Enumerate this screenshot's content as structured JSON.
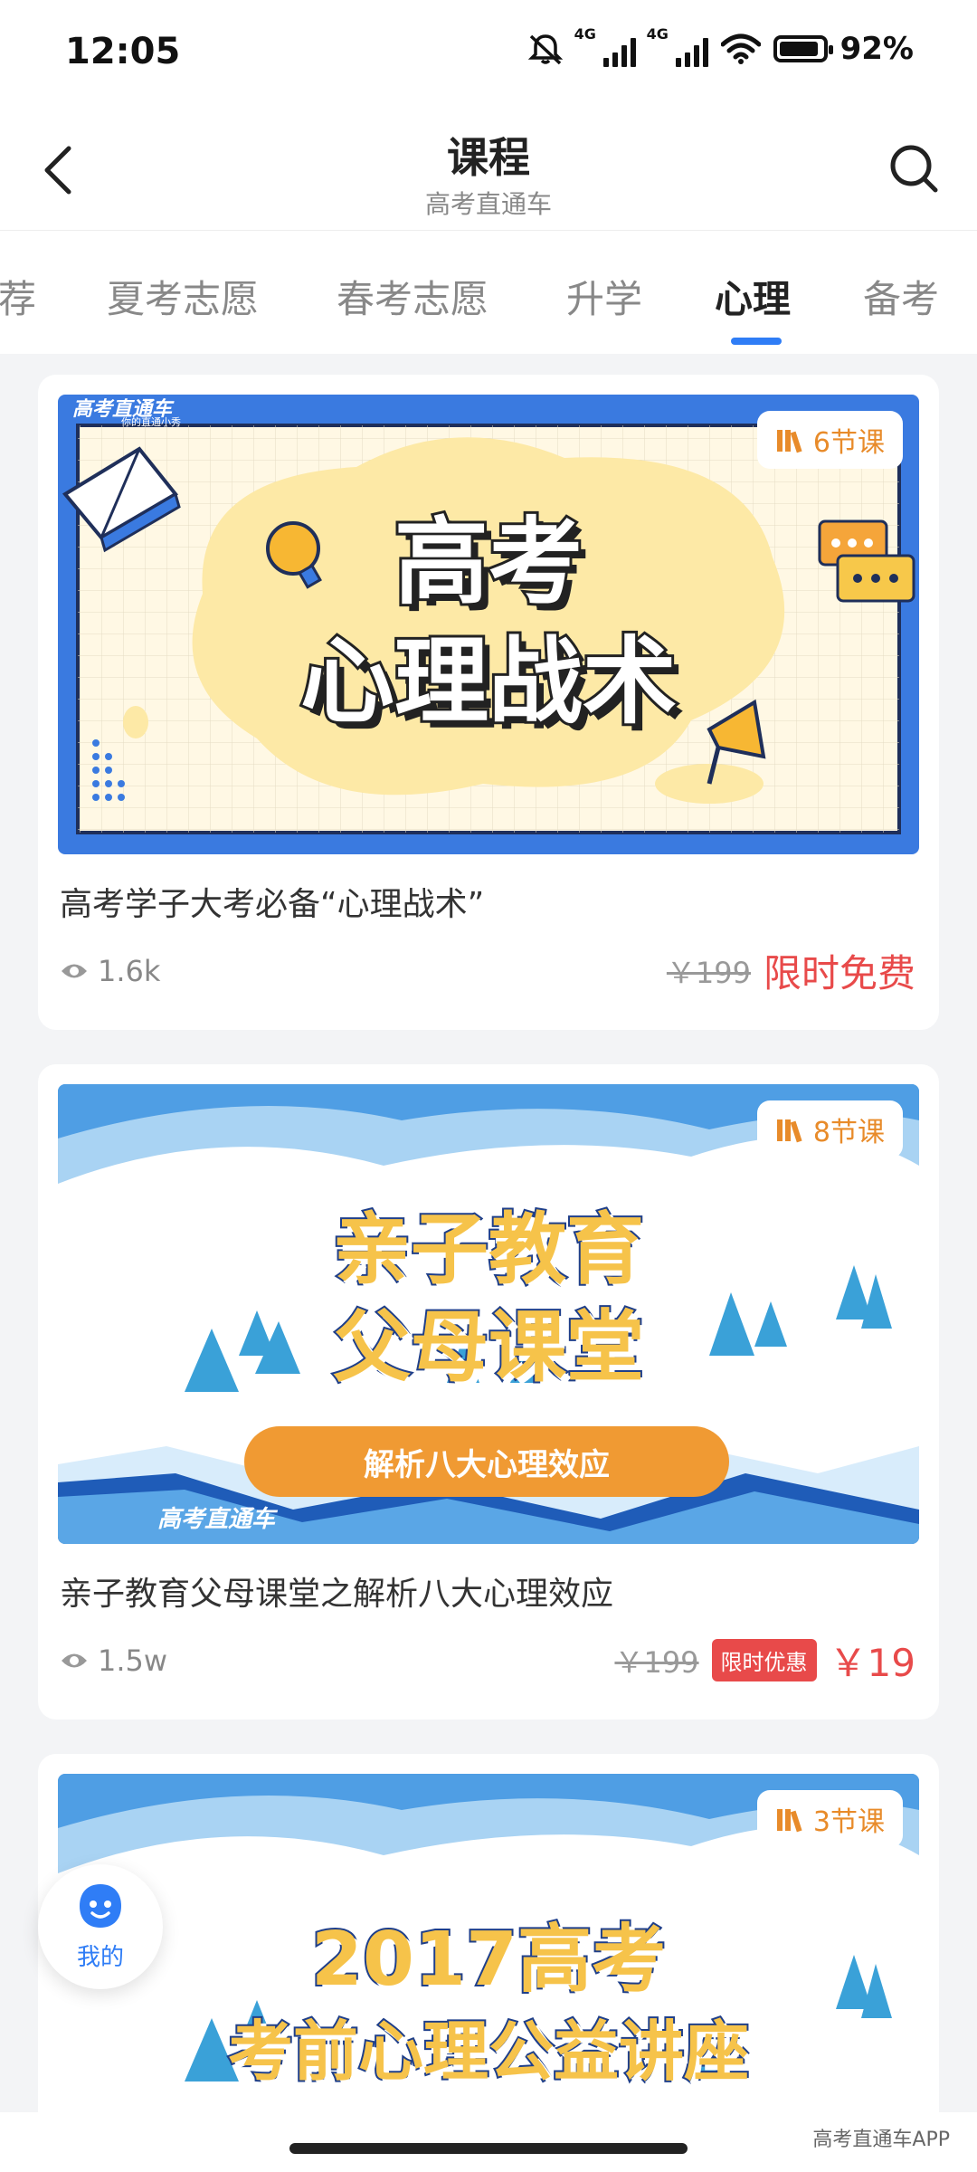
{
  "status_bar": {
    "time": "12:05",
    "network_1": "4G",
    "network_2": "4G",
    "battery_percent": "92%",
    "battery_level": 0.92,
    "icons": [
      "mute-icon",
      "signal-icon",
      "signal-icon",
      "wifi-icon",
      "battery-icon"
    ]
  },
  "header": {
    "title": "课程",
    "subtitle": "高考直通车",
    "icons": [
      "back-icon",
      "search-icon"
    ]
  },
  "tabs": {
    "items": [
      "荐",
      "夏考志愿",
      "春考志愿",
      "升学",
      "心理",
      "备考"
    ],
    "active": "心理",
    "accent": "#2f7df6"
  },
  "courses": [
    {
      "banner": {
        "brand": "高考直通车",
        "brand_sub": "你的直通小秀",
        "line1": "高考",
        "line2": "心理战术"
      },
      "lessons": "6节课",
      "title": "高考学子大考必备“心理战术”",
      "views": "1.6k",
      "original_price": "￥199",
      "price_label": "限时免费"
    },
    {
      "banner": {
        "line1": "亲子教育",
        "line2": "父母课堂",
        "pill": "解析八大心理效应",
        "brand": "高考直通车"
      },
      "lessons": "8节课",
      "title": "亲子教育父母课堂之解析八大心理效应",
      "views": "1.5w",
      "original_price": "￥199",
      "promo_tag": "限时优惠",
      "price": "￥19"
    },
    {
      "banner": {
        "line1": "2017高考",
        "line2": "考前心理公益讲座"
      },
      "lessons": "3节课"
    }
  ],
  "float_button": {
    "label": "我的"
  },
  "watermark": "高考直通车APP",
  "colors": {
    "accent_blue": "#2f7df6",
    "price_red": "#e84a4a",
    "badge_orange": "#e88b2a"
  }
}
